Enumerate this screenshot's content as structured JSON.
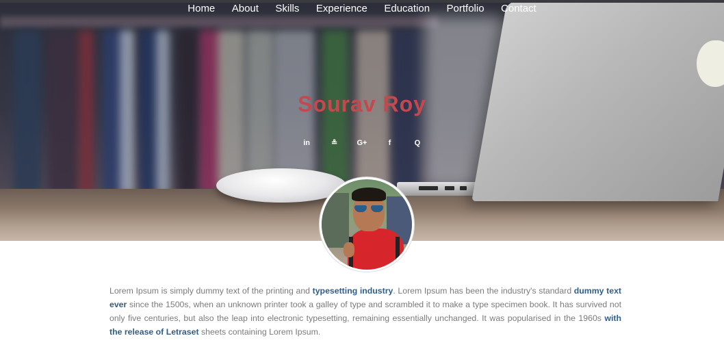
{
  "nav": {
    "items": [
      {
        "label": "Home"
      },
      {
        "label": "About"
      },
      {
        "label": "Skills"
      },
      {
        "label": "Experience"
      },
      {
        "label": "Education"
      },
      {
        "label": "Portfolio"
      },
      {
        "label": "Contact"
      }
    ]
  },
  "hero": {
    "name": "Sourav Roy",
    "social": [
      {
        "icon": "linkedin-icon",
        "glyph": "in"
      },
      {
        "icon": "stackoverflow-icon",
        "glyph": "≗"
      },
      {
        "icon": "google-plus-icon",
        "glyph": "G+"
      },
      {
        "icon": "facebook-icon",
        "glyph": "f"
      },
      {
        "icon": "quora-icon",
        "glyph": "Q"
      }
    ]
  },
  "about": {
    "p1": "Lorem Ipsum is simply dummy text of the printing and ",
    "b1": "typesetting industry",
    "p2": ". Lorem Ipsum has been the industry's standard ",
    "b2": "dummy text ever",
    "p3": " since the 1500s, when an unknown printer took a galley of type and scrambled it to make a type specimen book. It has survived not only five centuries, but also the leap into electronic typesetting, remaining essentially unchanged. It was popularised in the 1960s ",
    "b3": "with the release of Letraset",
    "p4": " sheets containing Lorem Ipsum."
  },
  "colors": {
    "name": "#c24a4f",
    "link_bold": "#2e5d8f",
    "body_text": "#7a7a7a"
  }
}
